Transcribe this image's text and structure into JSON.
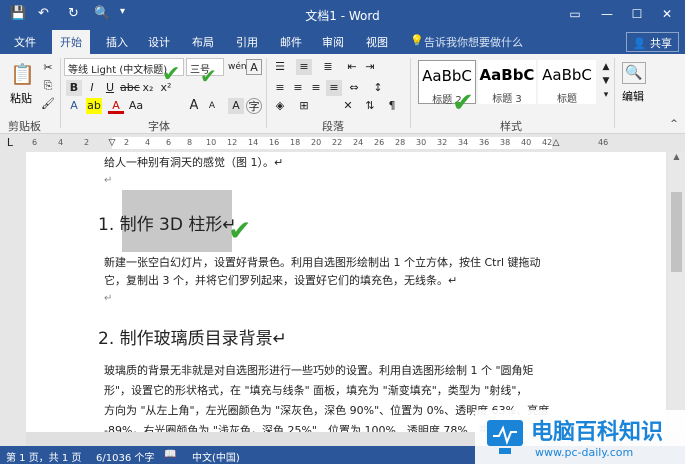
{
  "window": {
    "title": "文档1 - Word"
  },
  "tabs": [
    "文件",
    "开始",
    "插入",
    "设计",
    "布局",
    "引用",
    "邮件",
    "审阅",
    "视图"
  ],
  "tell_me": "告诉我你想要做什么",
  "share": "共享",
  "ribbon": {
    "paste": "粘贴",
    "font_name": "等线 Light (中文标题)",
    "font_size": "三号",
    "groups": [
      "剪贴板",
      "字体",
      "段落",
      "样式",
      "编辑"
    ],
    "styles": [
      {
        "sample": "AaBbC",
        "name": "标题 2"
      },
      {
        "sample": "AaBbC",
        "name": "标题 3"
      },
      {
        "sample": "AaBbC",
        "name": "标题"
      }
    ],
    "edit": "编辑"
  },
  "ruler_numbers": [
    "6",
    "4",
    "2",
    "2",
    "4",
    "6",
    "8",
    "10",
    "12",
    "14",
    "16",
    "18",
    "20",
    "22",
    "24",
    "26",
    "28",
    "30",
    "32",
    "34",
    "36",
    "38",
    "40",
    "42",
    "46"
  ],
  "doc": {
    "line1": "给人一种别有洞天的感觉（图 1）。↵",
    "mark1": "↵",
    "h1": "1. 制作 3D 柱形↵",
    "p1a": "新建一张空白幻灯片，设置好背景色。利用自选图形绘制出 1 个立方体，按住 Ctrl 键拖动",
    "p1b": "它，复制出 3 个，并将它们罗列起来，设置好它们的填充色，无线条。↵",
    "mark2": "↵",
    "h2": "2. 制作玻璃质目录背景↵",
    "p2a": "玻璃质的背景无非就是对自选图形进行一些巧妙的设置。利用自选图形绘制 1 个 \"圆角矩",
    "p2b": "形\"，设置它的形状格式，在 \"填充与线条\" 面板，填充为 \"渐变填充\"，类型为 \"射线\"，",
    "p2c": "方向为 \"从左上角\"，左光圈颜色为 \"深灰色，深色 90%\"、位置为 0%、透明度 63%、亮度",
    "p2d": "-89%，右光圈颜色为 \"浅灰色，深色 25%\"、位置为 100%、透明度 78%、亮度"
  },
  "status": {
    "page": "第 1 页，共 1 页",
    "words": "6/1036 个字",
    "lang": "中文(中国)"
  },
  "logo": {
    "cn": "电脑百科知识",
    "url": "www.pc-daily.com"
  },
  "colors": {
    "word_blue": "#2b579a",
    "check_green": "#3aa832"
  }
}
